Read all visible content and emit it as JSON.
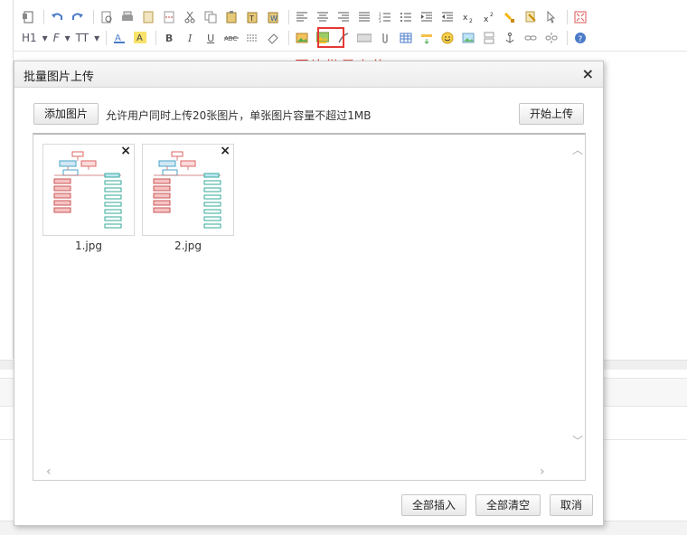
{
  "toolbar": {
    "row2_heading_label": "H1",
    "row2_font_label": "F",
    "row2_size_label": "TT",
    "annotation": "图片批量上传"
  },
  "dialog": {
    "title": "批量图片上传",
    "close_label": "×",
    "add_button": "添加图片",
    "hint": "允许用户同时上传20张图片，单张图片容量不超过1MB",
    "start_button": "开始上传",
    "images": [
      {
        "name": "1.jpg",
        "delete": "×"
      },
      {
        "name": "2.jpg",
        "delete": "×"
      }
    ],
    "insert_all_button": "全部插入",
    "clear_all_button": "全部清空",
    "cancel_button": "取消"
  },
  "colors": {
    "highlight": "#e53935",
    "annotation": "#e53935"
  }
}
